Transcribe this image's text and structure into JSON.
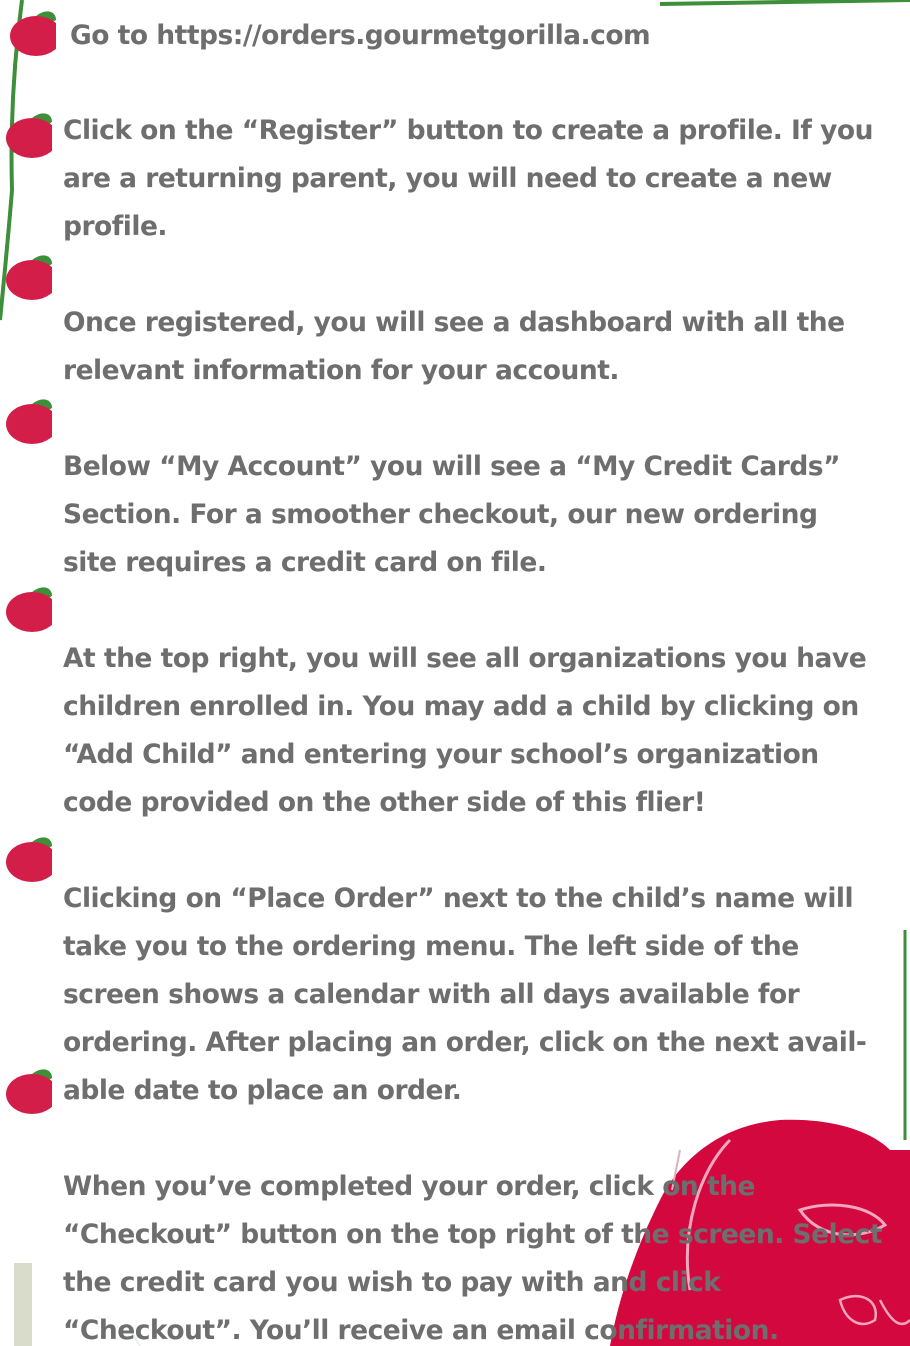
{
  "theme": {
    "text_color": "#6e6e6e",
    "accent_red": "#d41e4a",
    "accent_green": "#3e8f3a",
    "pink_blob": "#d3083f"
  },
  "bullet_icon": "apple-bullet-icon",
  "steps": [
    {
      "lines": [
        "Go to https://orders.gourmetgorilla.com"
      ]
    },
    {
      "lines": [
        "Click on the “Register” button to create a profile.   If you",
        "are a returning parent, you will need to create a new",
        "profile."
      ]
    },
    {
      "lines": [
        "Once registered, you will see a dashboard with all the",
        "relevant information for your account."
      ]
    },
    {
      "lines": [
        "Below  “My Account” you will see a  “My Credit Cards”",
        "Section.  For a smoother checkout, our new ordering",
        "site requires a credit card on file."
      ]
    },
    {
      "lines": [
        "At the top right, you will see all organizations you have",
        "children enrolled in.  You  may add a child by clicking on",
        "“Add Child” and entering  your school’s organization",
        "code provided on the other side of this flier!"
      ]
    },
    {
      "lines": [
        "Clicking on “Place Order” next to the child’s name will",
        "take you to the ordering menu.  The left side of the",
        "screen shows a calendar with all days available for",
        "ordering.  After placing an order, click on the next avail-",
        "able date to place an order."
      ]
    },
    {
      "lines": [
        "When you’ve completed your order, click on the",
        "“Checkout” button on the top right of the screen. Select",
        "the credit card you wish to pay with and click",
        "“Checkout”.   You’ll receive an email confirmation."
      ]
    }
  ]
}
